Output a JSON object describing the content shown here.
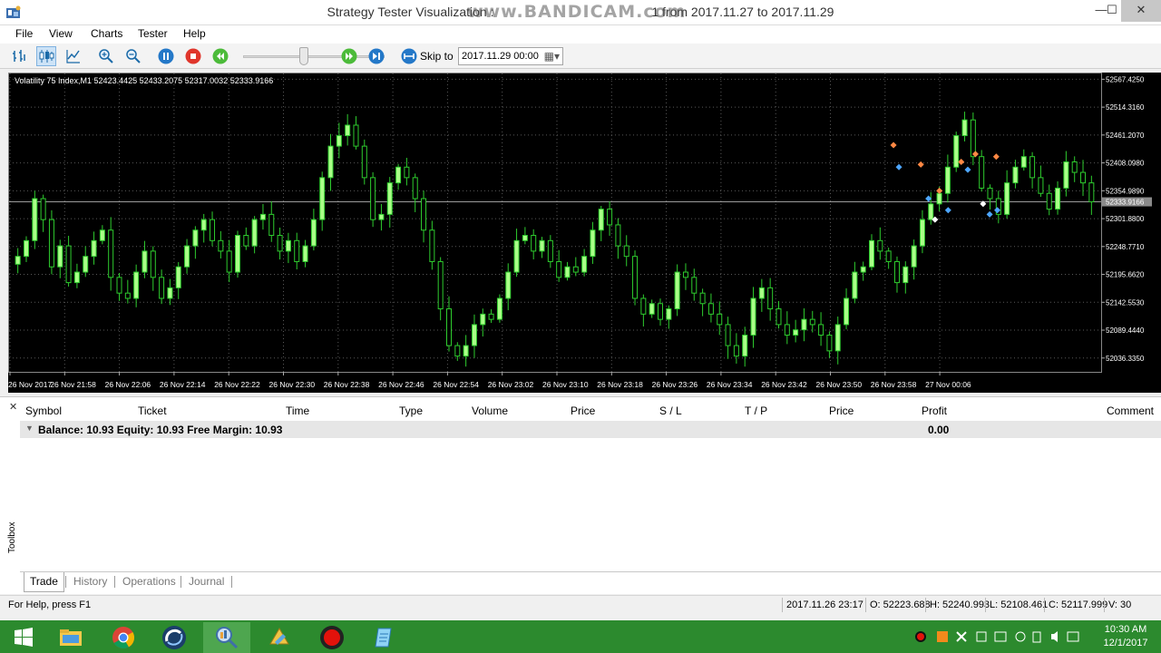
{
  "window": {
    "title": "Strategy Tester Visualization : www.BANDICAM.com 1 from 2017.11.27 to 2017.11.29",
    "title_left": "Strategy Tester Visualization : ",
    "watermark": "www.BANDICAM.com",
    "title_right": "1 from 2017.11.27 to 2017.11.29",
    "minimize": "—",
    "maximize": "☐",
    "close": "✕"
  },
  "menu": {
    "file": "File",
    "view": "View",
    "charts": "Charts",
    "tester": "Tester",
    "help": "Help"
  },
  "toolbar": {
    "skip_label": "Skip to",
    "skip_date": "2017.11.29 00:00",
    "buttons": [
      "bar-chart-icon",
      "candlestick-chart-icon",
      "line-chart-icon",
      "zoom-in-icon",
      "zoom-out-icon",
      "pause-icon",
      "stop-icon",
      "rewind-icon",
      "fast-forward-icon",
      "skip-end-icon",
      "skip-to-icon"
    ]
  },
  "chart": {
    "info": "Volatility 75 Index,M1  52423.4425 52433.2075 52317.0032 52333.9166",
    "current_price_label": "52333.9166",
    "colors": {
      "background": "#000000",
      "up": "#aaff88",
      "down": "#000000",
      "wick": "#2ecc2e",
      "grid": "#585858",
      "axis_text": "#ffffff"
    }
  },
  "chart_data": {
    "type": "candlestick",
    "title": "Volatility 75 Index,M1",
    "ohlc_header": {
      "open": 52423.4425,
      "high": 52433.2075,
      "low": 52317.0032,
      "close": 52333.9166
    },
    "y_ticks": [
      "52567.4250",
      "52514.3160",
      "52461.2070",
      "52408.0980",
      "52354.9890",
      "52301.8800",
      "52248.7710",
      "52195.6620",
      "52142.5530",
      "52089.4440",
      "52036.3350"
    ],
    "ylim": [
      52010,
      52575
    ],
    "x_ticks": [
      "26 Nov 2017",
      "26 Nov 21:58",
      "26 Nov 22:06",
      "26 Nov 22:14",
      "26 Nov 22:22",
      "26 Nov 22:30",
      "26 Nov 22:38",
      "26 Nov 22:46",
      "26 Nov 22:54",
      "26 Nov 23:02",
      "26 Nov 23:10",
      "26 Nov 23:18",
      "26 Nov 23:26",
      "26 Nov 23:34",
      "26 Nov 23:42",
      "26 Nov 23:50",
      "26 Nov 23:58",
      "27 Nov 00:06"
    ],
    "current_price": 52333.9166,
    "grid": true,
    "closes": [
      52230,
      52260,
      52340,
      52300,
      52210,
      52250,
      52180,
      52200,
      52230,
      52260,
      52280,
      52190,
      52160,
      52150,
      52200,
      52240,
      52190,
      52150,
      52170,
      52210,
      52250,
      52280,
      52300,
      52260,
      52240,
      52200,
      52270,
      52250,
      52300,
      52310,
      52270,
      52240,
      52260,
      52220,
      52250,
      52300,
      52380,
      52440,
      52460,
      52480,
      52440,
      52380,
      52300,
      52310,
      52370,
      52400,
      52380,
      52340,
      52280,
      52220,
      52130,
      52060,
      52040,
      52060,
      52100,
      52120,
      52110,
      52150,
      52200,
      52260,
      52270,
      52240,
      52260,
      52220,
      52190,
      52210,
      52200,
      52230,
      52280,
      52320,
      52290,
      52250,
      52230,
      52150,
      52120,
      52140,
      52110,
      52130,
      52200,
      52190,
      52160,
      52140,
      52120,
      52100,
      52060,
      52040,
      52080,
      52150,
      52170,
      52130,
      52100,
      52080,
      52090,
      52110,
      52100,
      52080,
      52050,
      52100,
      52150,
      52200,
      52210,
      52260,
      52240,
      52220,
      52180,
      52210,
      52250,
      52300,
      52330,
      52350,
      52400,
      52460,
      52490,
      52420,
      52360,
      52340,
      52310,
      52370,
      52400,
      52420,
      52380,
      52350,
      52320,
      52360,
      52410,
      52390,
      52370,
      52333.9166
    ],
    "trade_markers": "diamond-shaped open/close markers (blue, orange, white) near 27 Nov 00:00 - 00:06"
  },
  "terminal": {
    "columns": [
      "Symbol",
      "Ticket",
      "Time",
      "Type",
      "Volume",
      "Price",
      "S / L",
      "T / P",
      "Price",
      "Profit",
      "Comment"
    ],
    "balance_row": "Balance: 10.93  Equity: 10.93  Free Margin: 10.93",
    "profit": "0.00",
    "toolbox_label": "Toolbox",
    "tabs": [
      "Trade",
      "History",
      "Operations",
      "Journal"
    ],
    "active_tab": "Trade"
  },
  "statusbar": {
    "help": "For Help, press F1",
    "datetime": "2017.11.26 23:17",
    "open": "O: 52223.688",
    "high": "H: 52240.993",
    "low": "L: 52108.461",
    "close": "C: 52117.999",
    "volume": "V: 30"
  },
  "taskbar": {
    "apps": [
      "windows-start-icon",
      "file-explorer-icon",
      "chrome-icon",
      "metatrader-icon",
      "strategy-tester-icon",
      "metaeditor-icon",
      "bandicam-record-icon",
      "notepad-icon"
    ],
    "time": "10:30 AM",
    "date": "12/1/2017",
    "colors": {
      "background": "#2c8a2e",
      "active": "#4ea64f"
    }
  }
}
